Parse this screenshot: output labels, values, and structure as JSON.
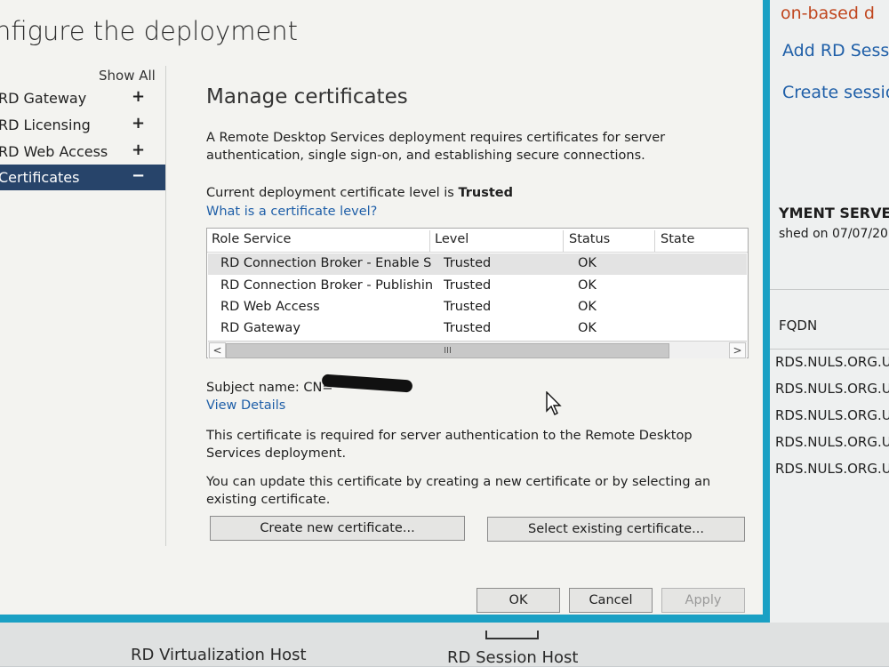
{
  "background": {
    "right": {
      "line1": "on-based d",
      "line2": "Add RD Sessi",
      "line3": "Create sessio",
      "heading": "YMENT SERVER",
      "published": "shed on 07/07/20",
      "fqdn_header": "FQDN",
      "fqdn_rows": [
        "RDS.NULS.ORG.UK",
        "RDS.NULS.ORG.UK",
        "RDS.NULS.ORG.UK",
        "RDS.NULS.ORG.UK",
        "RDS.NULS.ORG.UK"
      ]
    },
    "bottom": {
      "label1": "RD Virtualization Host",
      "label2": "RD Session Host"
    }
  },
  "dialog": {
    "title": "nfigure the deployment",
    "show_all": "Show All",
    "nav": [
      {
        "label": "RD Gateway",
        "sign": "+"
      },
      {
        "label": "RD Licensing",
        "sign": "+"
      },
      {
        "label": "RD Web Access",
        "sign": "+"
      },
      {
        "label": "Certificates",
        "sign": "−"
      }
    ],
    "section_title": "Manage certificates",
    "intro": "A Remote Desktop Services deployment requires certificates for server authentication, single sign-on, and establishing secure connections.",
    "level_prefix": "Current deployment certificate level is",
    "level_value": "Trusted",
    "level_link": "What is a certificate level?",
    "table": {
      "headers": [
        "Role Service",
        "Level",
        "Status",
        "State"
      ],
      "rows": [
        {
          "role": "RD Connection Broker - Enable Sing",
          "level": "Trusted",
          "status": "OK",
          "state": ""
        },
        {
          "role": "RD Connection Broker - Publishing",
          "level": "Trusted",
          "status": "OK",
          "state": ""
        },
        {
          "role": "RD Web Access",
          "level": "Trusted",
          "status": "OK",
          "state": ""
        },
        {
          "role": "RD Gateway",
          "level": "Trusted",
          "status": "OK",
          "state": ""
        }
      ],
      "scroll_left": "<",
      "scroll_right": ">",
      "scroll_grip": "III"
    },
    "subject_label": "Subject name: CN=",
    "view_details": "View Details",
    "cert_required": "This certificate is required for server authentication to the Remote Desktop Services deployment.",
    "update_info": "You can update this certificate by creating a new certificate or by selecting an existing certificate.",
    "create_button": "Create new certificate...",
    "select_button": "Select existing certificate...",
    "ok_button": "OK",
    "cancel_button": "Cancel",
    "apply_button": "Apply"
  },
  "colors": {
    "accent_border": "#1aa0c4",
    "nav_selected": "#27446a",
    "link": "#1f5fa8"
  }
}
